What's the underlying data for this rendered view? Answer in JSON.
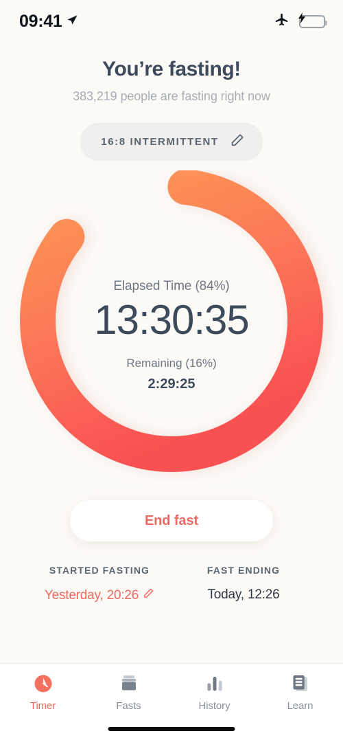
{
  "status_bar": {
    "time": "09:41",
    "location_icon": "location-arrow-icon",
    "airplane_icon": "airplane-mode-icon",
    "battery_icon": "battery-charging-icon"
  },
  "header": {
    "title": "You’re fasting!",
    "subtitle": "383,219 people are fasting right now"
  },
  "plan": {
    "label": "16:8 INTERMITTENT",
    "edit_icon": "pencil-edit-icon"
  },
  "timer": {
    "elapsed_label": "Elapsed Time (84%)",
    "elapsed_time": "13:30:35",
    "remaining_label": "Remaining (16%)",
    "remaining_time": "2:29:25",
    "elapsed_percent": 84,
    "remaining_percent": 16,
    "ring_gradient_start": "#FB9153",
    "ring_gradient_mid": "#FC7D57",
    "ring_gradient_end": "#FA5352",
    "ring_track_color": "#F5534F"
  },
  "actions": {
    "end_fast_label": "End fast"
  },
  "fast_info": {
    "started": {
      "heading": "STARTED FASTING",
      "value": "Yesterday, 20:26",
      "edit_icon": "pencil-edit-icon"
    },
    "ending": {
      "heading": "FAST ENDING",
      "value": "Today, 12:26"
    }
  },
  "tabs": [
    {
      "label": "Timer",
      "icon": "timer-clock-icon",
      "active": true
    },
    {
      "label": "Fasts",
      "icon": "food-stack-icon",
      "active": false
    },
    {
      "label": "History",
      "icon": "bar-chart-icon",
      "active": false
    },
    {
      "label": "Learn",
      "icon": "article-doc-icon",
      "active": false
    }
  ],
  "colors": {
    "background": "#FCFAF7",
    "accent": "#F0695F",
    "text_dark": "#3D4A5C",
    "text_muted": "#8A9099"
  }
}
